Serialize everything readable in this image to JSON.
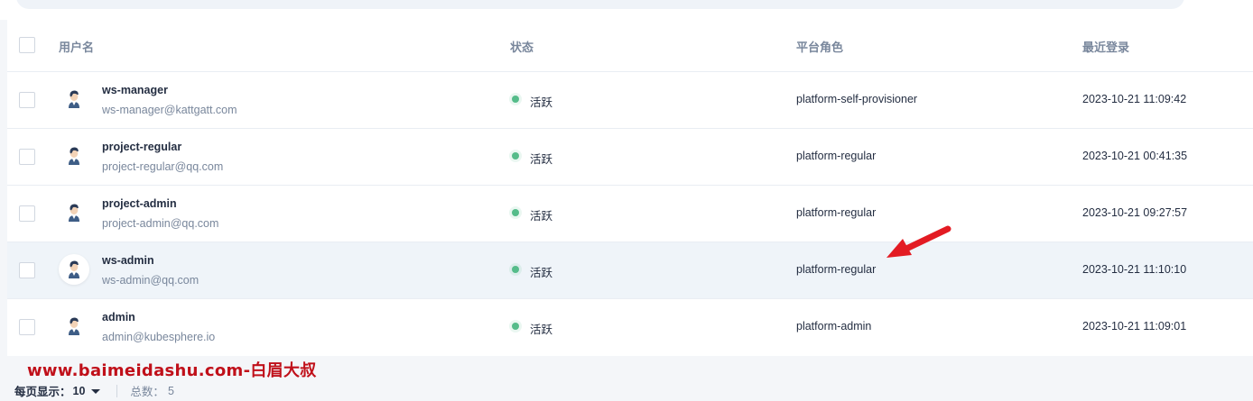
{
  "table": {
    "headers": {
      "username": "用户名",
      "status": "状态",
      "platform_role": "平台角色",
      "last_login": "最近登录"
    },
    "rows": [
      {
        "username": "ws-manager",
        "email": "ws-manager@kattgatt.com",
        "status": "活跃",
        "role": "platform-self-provisioner",
        "last_login": "2023-10-21 11:09:42"
      },
      {
        "username": "project-regular",
        "email": "project-regular@qq.com",
        "status": "活跃",
        "role": "platform-regular",
        "last_login": "2023-10-21 00:41:35"
      },
      {
        "username": "project-admin",
        "email": "project-admin@qq.com",
        "status": "活跃",
        "role": "platform-regular",
        "last_login": "2023-10-21 09:27:57"
      },
      {
        "username": "ws-admin",
        "email": "ws-admin@qq.com",
        "status": "活跃",
        "role": "platform-regular",
        "last_login": "2023-10-21 11:10:10"
      },
      {
        "username": "admin",
        "email": "admin@kubesphere.io",
        "status": "活跃",
        "role": "platform-admin",
        "last_login": "2023-10-21 11:09:01"
      }
    ],
    "highlighted_row_index": 3
  },
  "footer": {
    "page_size_label": "每页显示：",
    "page_size": "10",
    "total_label": "总数：",
    "total": "5"
  },
  "watermark": "www.baimeidashu.com-白眉大叔",
  "colors": {
    "status_active": "#55bc8a",
    "arrow": "#e31b23",
    "watermark": "#c0101a",
    "row_highlight": "#eff4f9"
  },
  "icons": {
    "avatar": "user-avatar-icon",
    "caret": "caret-down-icon",
    "annotation": "red-arrow-icon"
  }
}
